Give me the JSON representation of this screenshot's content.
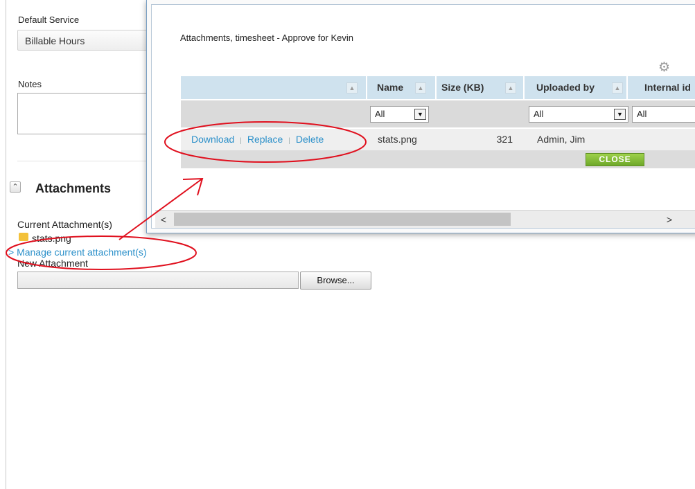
{
  "form": {
    "default_service_label": "Default Service",
    "default_service_value": "Billable Hours",
    "notes_label": "Notes",
    "attachments_title": "Attachments",
    "collapse_icon": "double-chevron-up-icon",
    "current_attachments_label": "Current Attachment(s)",
    "current_file_name": "stats.png",
    "manage_link": "> Manage current attachment(s)",
    "new_attachment_label": "New Attachment",
    "browse_label": "Browse..."
  },
  "modal": {
    "title": "Attachments, timesheet - Approve for Kevin",
    "settings_icon": "gear-icon",
    "columns": [
      {
        "label": ""
      },
      {
        "label": "Name"
      },
      {
        "label": "Size (KB)"
      },
      {
        "label": "Uploaded by"
      },
      {
        "label": "Internal id"
      }
    ],
    "filters": {
      "name": "All",
      "uploaded_by": "All",
      "internal_id": "All"
    },
    "row": {
      "actions": {
        "download": "Download",
        "replace": "Replace",
        "delete": "Delete"
      },
      "name": "stats.png",
      "size_kb": "321",
      "uploaded_by": "Admin, Jim"
    },
    "close_label": "CLOSE",
    "scroll_left": "<",
    "scroll_right": ">"
  },
  "colors": {
    "link": "#2a8fc9",
    "header_bg": "#cfe2ee",
    "close_button": "#7cb735",
    "annotation_red": "#e0101e"
  }
}
